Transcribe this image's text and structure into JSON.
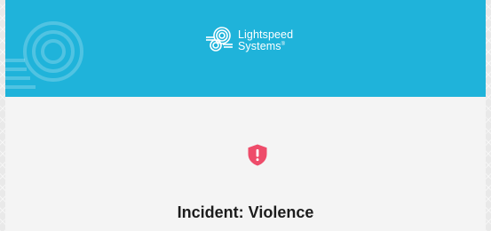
{
  "header": {
    "brand_name_line1": "Lightspeed",
    "brand_name_line2": "Systems",
    "brand_trademark": "®",
    "background_color": "#1fb3da"
  },
  "alert": {
    "icon": "shield-alert-icon",
    "icon_color": "#ee4c6a",
    "title": "Incident: Violence"
  }
}
